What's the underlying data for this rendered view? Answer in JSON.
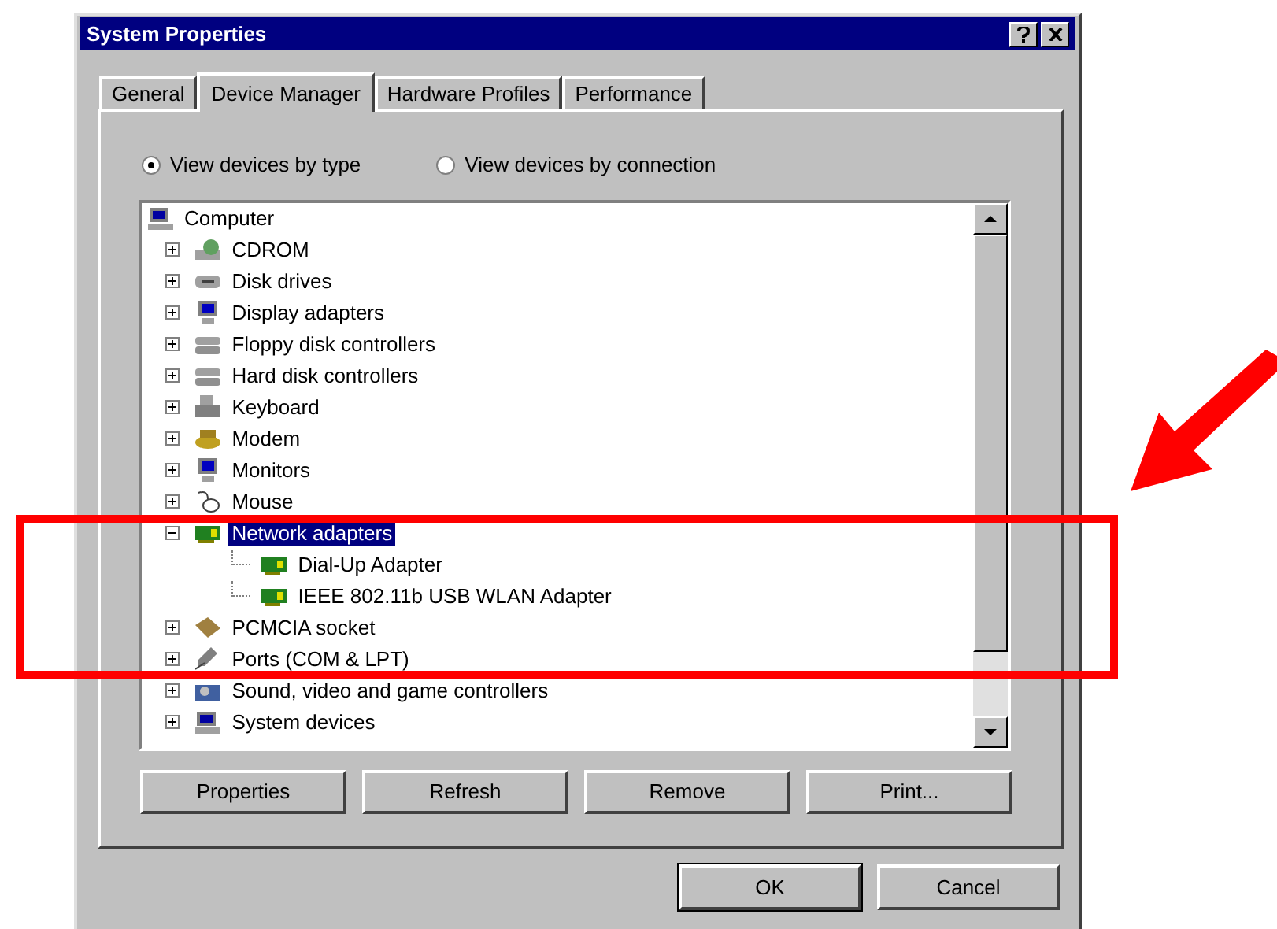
{
  "window": {
    "title": "System Properties"
  },
  "tabs": [
    {
      "label": "General",
      "selected": false
    },
    {
      "label": "Device Manager",
      "selected": true
    },
    {
      "label": "Hardware Profiles",
      "selected": false
    },
    {
      "label": "Performance",
      "selected": false
    }
  ],
  "view_options": [
    {
      "label": "View devices by type",
      "selected": true
    },
    {
      "label": "View devices by connection",
      "selected": false
    }
  ],
  "tree": {
    "label": "Computer",
    "kind": "computer",
    "children": [
      {
        "label": "CDROM",
        "kind": "cdrom",
        "expanded": false,
        "selected": false
      },
      {
        "label": "Disk drives",
        "kind": "disk",
        "expanded": false,
        "selected": false
      },
      {
        "label": "Display adapters",
        "kind": "monitor",
        "expanded": false,
        "selected": false
      },
      {
        "label": "Floppy disk controllers",
        "kind": "controller",
        "expanded": false,
        "selected": false
      },
      {
        "label": "Hard disk controllers",
        "kind": "controller",
        "expanded": false,
        "selected": false
      },
      {
        "label": "Keyboard",
        "kind": "keyboard",
        "expanded": false,
        "selected": false
      },
      {
        "label": "Modem",
        "kind": "modem",
        "expanded": false,
        "selected": false
      },
      {
        "label": "Monitors",
        "kind": "monitor",
        "expanded": false,
        "selected": false
      },
      {
        "label": "Mouse",
        "kind": "mouse",
        "expanded": false,
        "selected": false
      },
      {
        "label": "Network adapters",
        "kind": "network",
        "expanded": true,
        "selected": true,
        "children": [
          {
            "label": "Dial-Up Adapter",
            "kind": "network",
            "selected": false
          },
          {
            "label": "IEEE 802.11b USB WLAN Adapter",
            "kind": "network",
            "selected": false
          }
        ]
      },
      {
        "label": "PCMCIA socket",
        "kind": "card",
        "expanded": false,
        "selected": false
      },
      {
        "label": "Ports (COM & LPT)",
        "kind": "port",
        "expanded": false,
        "selected": false
      },
      {
        "label": "Sound, video and game controllers",
        "kind": "sound",
        "expanded": false,
        "selected": false
      },
      {
        "label": "System devices",
        "kind": "computer",
        "expanded": false,
        "selected": false
      }
    ]
  },
  "actions": [
    "Properties",
    "Refresh",
    "Remove",
    "Print..."
  ],
  "buttons": [
    "OK",
    "Cancel"
  ]
}
